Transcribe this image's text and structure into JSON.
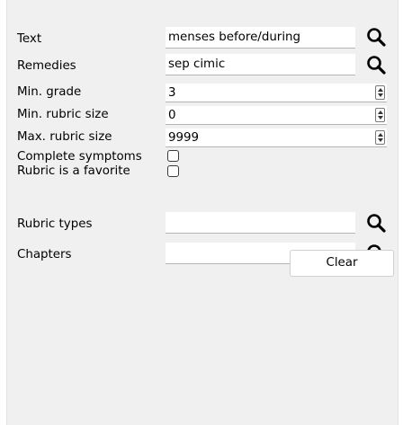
{
  "filters": {
    "text_label": "Text",
    "text_value": "menses before/during",
    "remedies_label": "Remedies",
    "remedies_value": "sep cimic",
    "min_grade_label": "Min. grade",
    "min_grade_value": "3",
    "min_rubric_size_label": "Min. rubric size",
    "min_rubric_size_value": "0",
    "max_rubric_size_label": "Max. rubric size",
    "max_rubric_size_value": "9999",
    "complete_symptoms_label": "Complete symptoms",
    "complete_symptoms_checked": false,
    "rubric_favorite_label": "Rubric is a favorite",
    "rubric_favorite_checked": false,
    "rubric_types_label": "Rubric types",
    "rubric_types_value": "",
    "chapters_label": "Chapters",
    "chapters_value": "",
    "clear_label": "Clear"
  },
  "icons": {
    "search": "search-icon",
    "spin": "spin-arrows-icon"
  }
}
